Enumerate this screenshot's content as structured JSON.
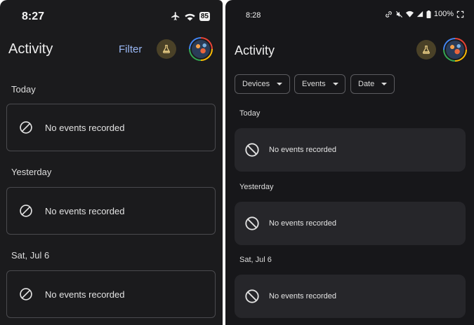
{
  "left_screen": {
    "status_time": "8:27",
    "battery": "85",
    "title": "Activity",
    "filter_label": "Filter",
    "sections": [
      {
        "label": "Today",
        "message": "No events recorded"
      },
      {
        "label": "Yesterday",
        "message": "No events recorded"
      },
      {
        "label": "Sat, Jul 6",
        "message": "No events recorded"
      }
    ]
  },
  "right_screen": {
    "status_time": "8:28",
    "battery": "100%",
    "title": "Activity",
    "chips": [
      {
        "label": "Devices"
      },
      {
        "label": "Events"
      },
      {
        "label": "Date"
      }
    ],
    "sections": [
      {
        "label": "Today",
        "message": "No events recorded"
      },
      {
        "label": "Yesterday",
        "message": "No events recorded"
      },
      {
        "label": "Sat, Jul 6",
        "message": "No events recorded"
      }
    ]
  },
  "icons": {
    "labs": "flask-icon",
    "empty": "no-entry-icon",
    "airplane": "airplane-icon",
    "wifi": "wifi-icon"
  },
  "colors": {
    "background": "#1b1b1d",
    "accent": "#9ab8f5",
    "labs_icon": "#f2d58a"
  }
}
